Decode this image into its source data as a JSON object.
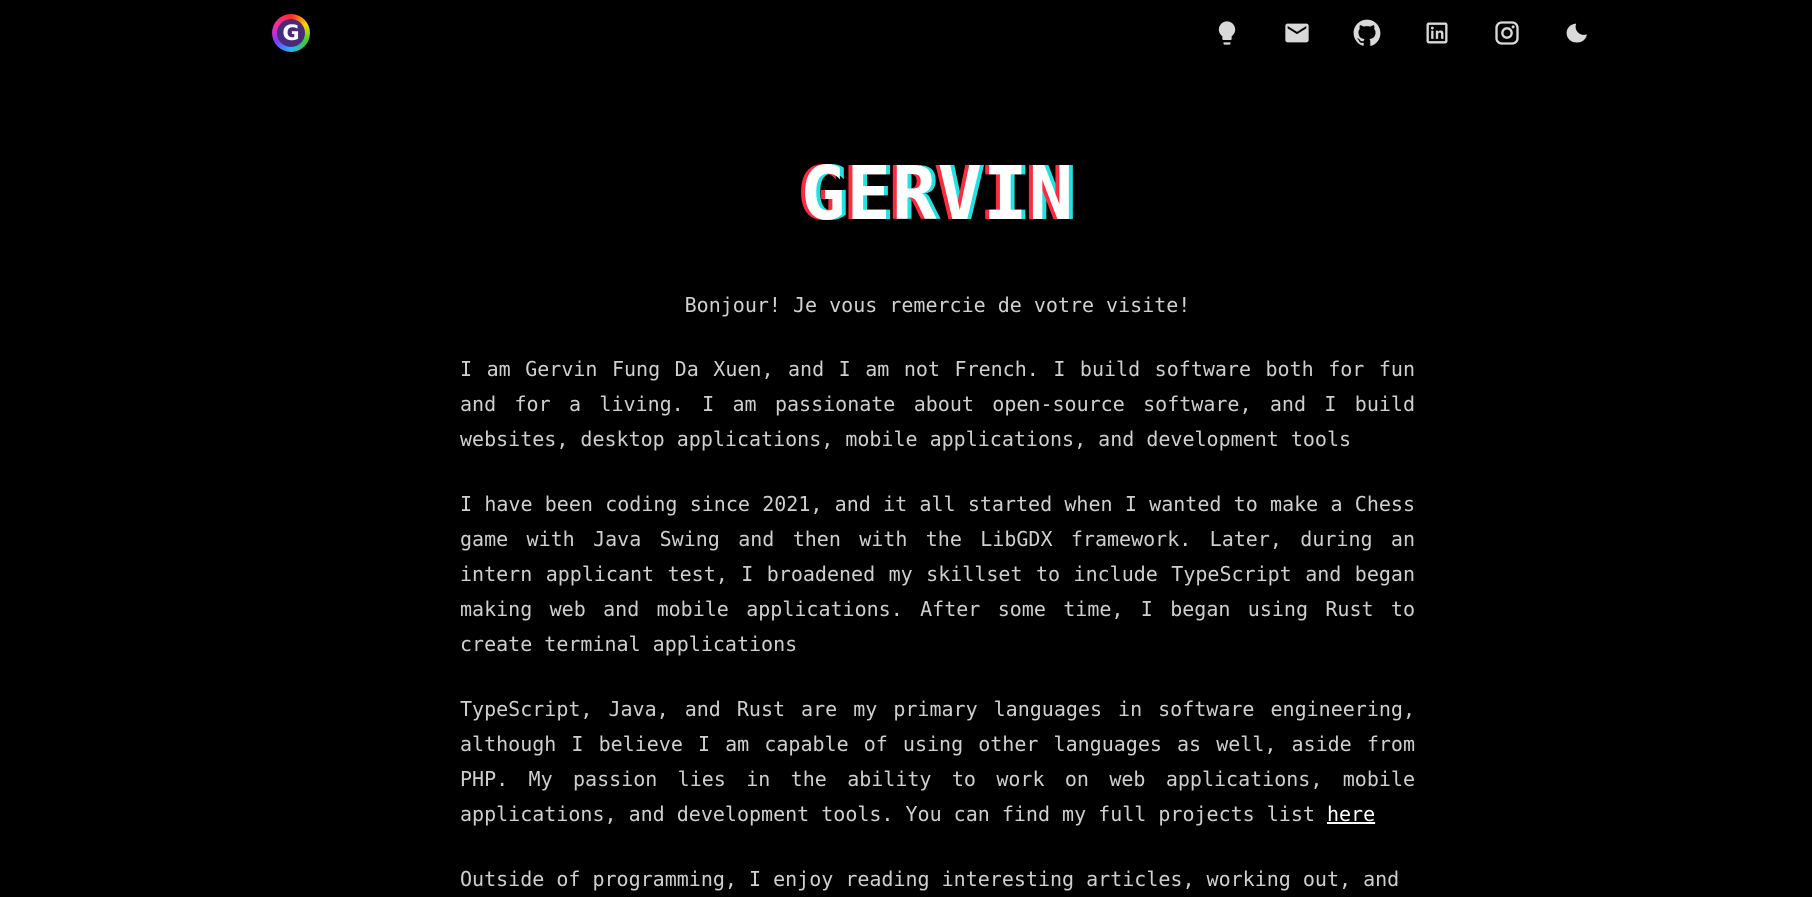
{
  "header": {
    "logo_letter": "G",
    "icons": [
      "bulb-icon",
      "mail-icon",
      "github-icon",
      "linkedin-icon",
      "instagram-icon",
      "moon-icon"
    ]
  },
  "hero": {
    "title": "GERVIN",
    "greeting": "Bonjour! Je vous remercie de votre visite!"
  },
  "content": {
    "p1": "I am Gervin Fung Da Xuen, and I am not French. I build software both for fun and for a living. I am passionate about open-source software, and I build websites, desktop applications, mobile applications, and development tools",
    "p2": "I have been coding since 2021, and it all started when I wanted to make a Chess game with Java Swing and then with the LibGDX framework. Later, during an intern applicant test, I broadened my skillset to include TypeScript and began making web and mobile applications. After some time, I began using Rust to create terminal applications",
    "p3": "TypeScript, Java, and Rust are my primary languages in software engineering, although I believe I am capable of using other languages as well, aside from PHP. My passion lies in the ability to work on web applications, mobile applications, and development tools. You can find my full projects list ",
    "p3_link": "here",
    "p4": "Outside of programming, I enjoy reading interesting articles, working out, and"
  },
  "colors": {
    "background": "#000000",
    "text": "#cfcfcf",
    "title_red": "#ff2a3c",
    "title_cyan": "#1fe3e3"
  }
}
